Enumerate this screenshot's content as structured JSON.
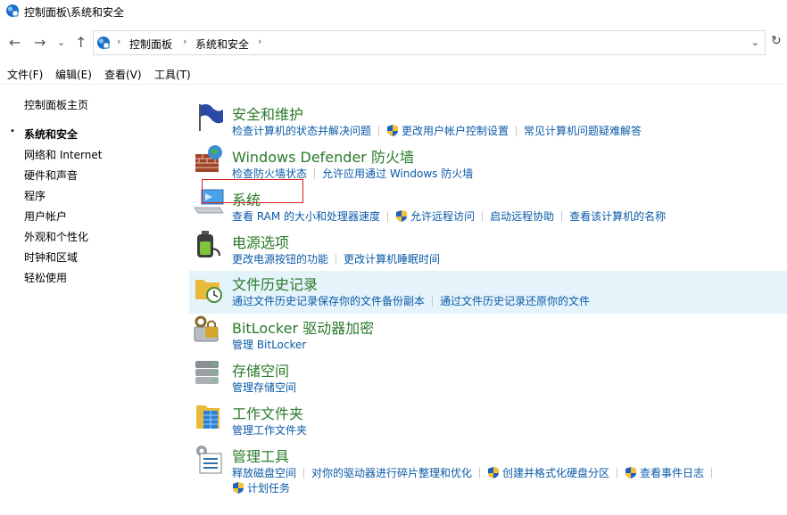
{
  "window": {
    "title": "控制面板\\系统和安全"
  },
  "nav": {
    "back": "←",
    "forward": "→",
    "recent": "⌄",
    "up": "↑",
    "refresh": "↻"
  },
  "address": {
    "crumbs": [
      "控制面板",
      "系统和安全"
    ],
    "separator": "›",
    "dropdown": "⌄"
  },
  "menu": [
    "文件(F)",
    "编辑(E)",
    "查看(V)",
    "工具(T)"
  ],
  "sidebar": {
    "items": [
      {
        "label": "控制面板主页",
        "active": false
      },
      {
        "label": "系统和安全",
        "active": true
      },
      {
        "label": "网络和 Internet",
        "active": false
      },
      {
        "label": "硬件和声音",
        "active": false
      },
      {
        "label": "程序",
        "active": false
      },
      {
        "label": "用户帐户",
        "active": false
      },
      {
        "label": "外观和个性化",
        "active": false
      },
      {
        "label": "时钟和区域",
        "active": false
      },
      {
        "label": "轻松使用",
        "active": false
      }
    ],
    "bullet": "•"
  },
  "categories": [
    {
      "title": "安全和维护",
      "icon": "flag-icon",
      "links": [
        {
          "label": "检查计算机的状态并解决问题",
          "shield": false
        },
        {
          "label": "更改用户帐户控制设置",
          "shield": true
        },
        {
          "label": "常见计算机问题疑难解答",
          "shield": false
        }
      ]
    },
    {
      "title": "Windows Defender 防火墙",
      "icon": "firewall-icon",
      "links": [
        {
          "label": "检查防火墙状态",
          "shield": false
        },
        {
          "label": "允许应用通过 Windows 防火墙",
          "shield": false
        }
      ]
    },
    {
      "title": "系统",
      "icon": "computer-icon",
      "links": [
        {
          "label": "查看 RAM 的大小和处理器速度",
          "shield": false
        },
        {
          "label": "允许远程访问",
          "shield": true
        },
        {
          "label": "启动远程协助",
          "shield": false
        },
        {
          "label": "查看该计算机的名称",
          "shield": false
        }
      ]
    },
    {
      "title": "电源选项",
      "icon": "battery-icon",
      "links": [
        {
          "label": "更改电源按钮的功能",
          "shield": false
        },
        {
          "label": "更改计算机睡眠时间",
          "shield": false
        }
      ]
    },
    {
      "title": "文件历史记录",
      "icon": "file-history-icon",
      "links": [
        {
          "label": "通过文件历史记录保存你的文件备份副本",
          "shield": false
        },
        {
          "label": "通过文件历史记录还原你的文件",
          "shield": false
        }
      ]
    },
    {
      "title": "BitLocker 驱动器加密",
      "icon": "bitlocker-icon",
      "links": [
        {
          "label": "管理 BitLocker",
          "shield": false
        }
      ]
    },
    {
      "title": "存储空间",
      "icon": "storage-icon",
      "links": [
        {
          "label": "管理存储空间",
          "shield": false
        }
      ]
    },
    {
      "title": "工作文件夹",
      "icon": "work-folders-icon",
      "links": [
        {
          "label": "管理工作文件夹",
          "shield": false
        }
      ]
    },
    {
      "title": "管理工具",
      "icon": "admin-tools-icon",
      "links": [
        {
          "label": "释放磁盘空间",
          "shield": false
        },
        {
          "label": "对你的驱动器进行碎片整理和优化",
          "shield": false
        },
        {
          "label": "创建并格式化硬盘分区",
          "shield": true
        },
        {
          "label": "查看事件日志",
          "shield": true
        }
      ],
      "links2": [
        {
          "label": "计划任务",
          "shield": true
        }
      ]
    }
  ],
  "colors": {
    "title_green": "#2a7a2a",
    "link_blue": "#0a5aa8",
    "highlight": "#e5f3fb",
    "red_box": "#d82020"
  }
}
